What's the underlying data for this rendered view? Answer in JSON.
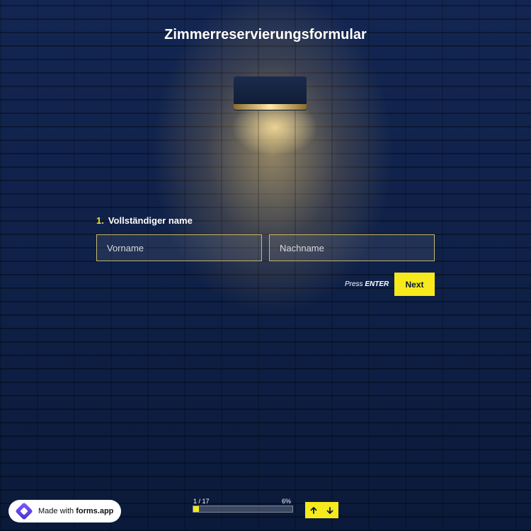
{
  "form": {
    "title": "Zimmerreservierungsformular",
    "question": {
      "number": "1.",
      "label": "Vollständiger name",
      "first_name_placeholder": "Vorname",
      "last_name_placeholder": "Nachname",
      "first_name_value": "",
      "last_name_value": ""
    },
    "hint_prefix": "Press",
    "hint_key": "ENTER",
    "next_label": "Next"
  },
  "progress": {
    "count_text": "1 / 17",
    "percent_text": "6%",
    "fraction": 0.06
  },
  "footer": {
    "badge_prefix": "Made with ",
    "badge_brand": "forms.app"
  },
  "colors": {
    "accent": "#f6ea1c",
    "background": "#0e1f42"
  },
  "icons": {
    "up": "arrow-up-icon",
    "down": "arrow-down-icon",
    "logo": "forms-app-logo-icon"
  }
}
